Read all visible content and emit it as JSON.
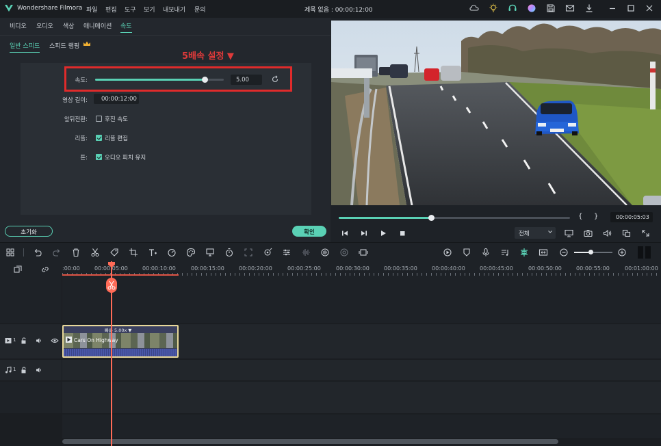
{
  "titlebar": {
    "app_name": "Wondershare Filmora",
    "menus": [
      "파일",
      "편집",
      "도구",
      "보기",
      "내보내기",
      "문의"
    ],
    "doc_title": "제목 없음 : 00:00:12:00"
  },
  "panel": {
    "tabs": [
      "비디오",
      "오디오",
      "색상",
      "애니메이션",
      "속도"
    ],
    "active_tab": "속도",
    "subtabs": [
      "일반 스피드",
      "스피드 램핑"
    ],
    "annotation": "5배속 설정 ▼",
    "speed_label": "속도:",
    "speed_value": "5.00",
    "speed_slider_fraction": 0.85,
    "duration_label": "영상 길이:",
    "duration_value": "00:00:12:00",
    "reverse_label": "앞뒤전환:",
    "reverse_option": "후진 속도",
    "ripple_label": "리플:",
    "ripple_option": "리플 편집",
    "pitch_label": "톤:",
    "pitch_option": "오디오 피치 유지",
    "reset_button": "초기화",
    "ok_button": "확인"
  },
  "player": {
    "progress_fraction": 0.4,
    "brace_open": "{",
    "brace_close": "}",
    "timecode": "00:00:05:03",
    "quality": "전체"
  },
  "timeline": {
    "ruler_ticks": [
      ":00:00",
      "00:00:05:00",
      "00:00:10:00",
      "00:00:15:00",
      "00:00:20:00",
      "00:00:25:00",
      "00:00:30:00",
      "00:00:35:00",
      "00:00:40:00",
      "00:00:45:00",
      "00:00:50:00",
      "00:00:55:00",
      "00:01:00:00"
    ],
    "clip_speed_label": "빠름 5.00x ▼",
    "clip_name": "Cars On Highway",
    "video_track_num": "1",
    "audio_track_num": "1"
  },
  "colors": {
    "accent": "#5ad1b5",
    "annotation_red": "#e03a3a",
    "playhead": "#ff6b57",
    "clip_border": "#e8d89a"
  }
}
